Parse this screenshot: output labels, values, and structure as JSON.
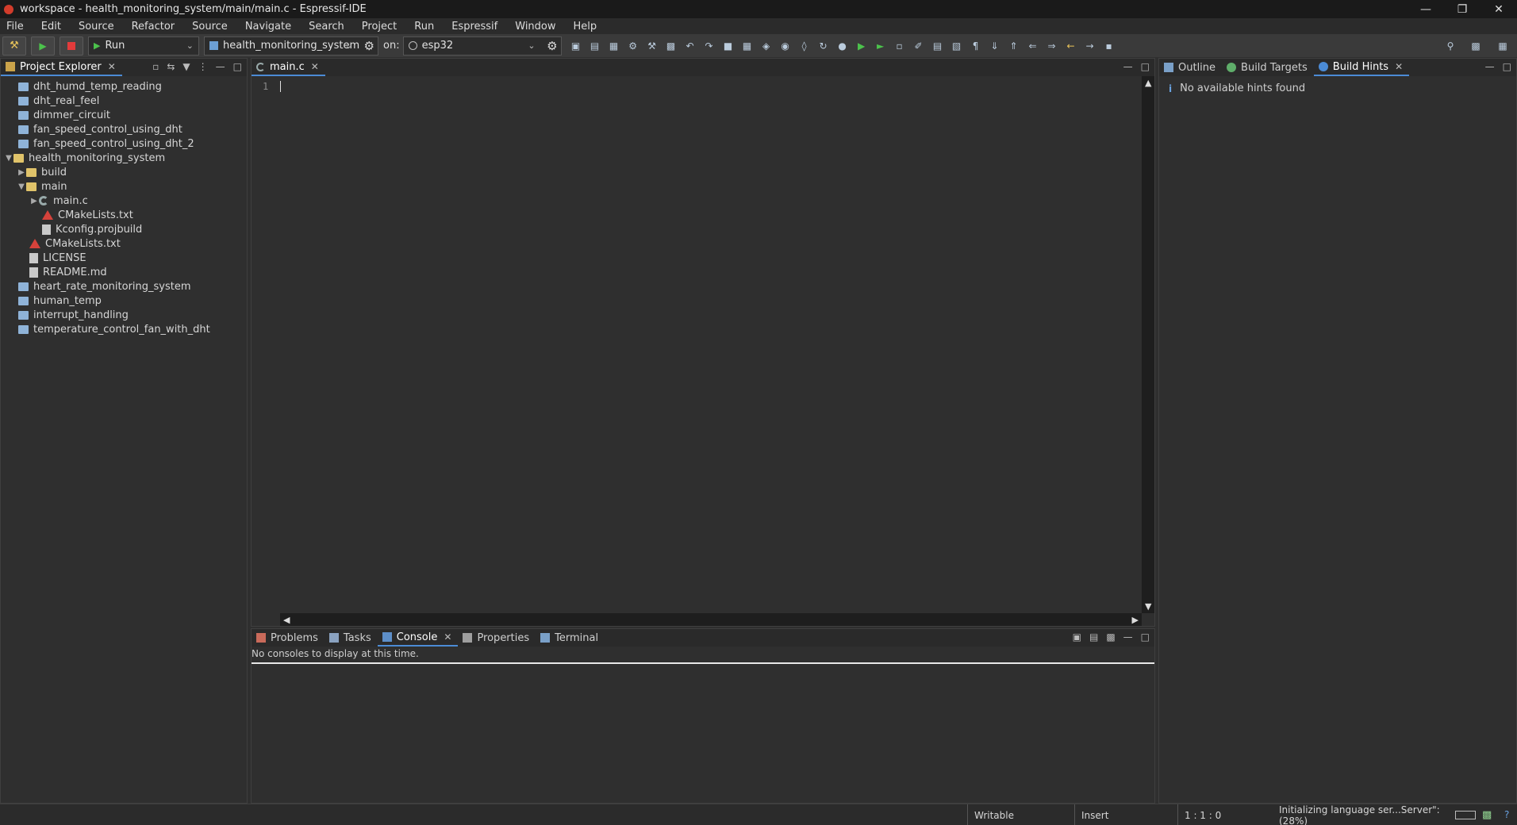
{
  "window": {
    "title": "workspace - health_monitoring_system/main/main.c - Espressif-IDE"
  },
  "menu": [
    "File",
    "Edit",
    "Source",
    "Refactor",
    "Source",
    "Navigate",
    "Search",
    "Project",
    "Run",
    "Espressif",
    "Window",
    "Help"
  ],
  "toolbar": {
    "mode": "Run",
    "project": "health_monitoring_system",
    "on_label": "on:",
    "target": "esp32"
  },
  "project_explorer": {
    "tab_label": "Project Explorer",
    "items": [
      "dht_humd_temp_reading",
      "dht_real_feel",
      "dimmer_circuit",
      "fan_speed_control_using_dht",
      "fan_speed_control_using_dht_2",
      "health_monitoring_system",
      "build",
      "main",
      "main.c",
      "CMakeLists.txt",
      "Kconfig.projbuild",
      "CMakeLists.txt",
      "LICENSE",
      "README.md",
      "heart_rate_monitoring_system",
      "human_temp",
      "interrupt_handling",
      "temperature_control_fan_with_dht"
    ]
  },
  "editor": {
    "tab_label": "main.c",
    "line_number": "1"
  },
  "right_panel": {
    "tabs": [
      "Outline",
      "Build Targets",
      "Build Hints"
    ],
    "message": "No available hints found"
  },
  "bottom_panel": {
    "tabs": [
      "Problems",
      "Tasks",
      "Console",
      "Properties",
      "Terminal"
    ],
    "message": "No consoles to display at this time."
  },
  "status": {
    "writable": "Writable",
    "insert": "Insert",
    "position": "1 : 1 : 0",
    "progress": "Initializing language ser...Server\": (28%)"
  },
  "colors": {
    "accent": "#4b8bd6",
    "background": "#2f2f2f",
    "titlebar": "#1a1a1a"
  }
}
